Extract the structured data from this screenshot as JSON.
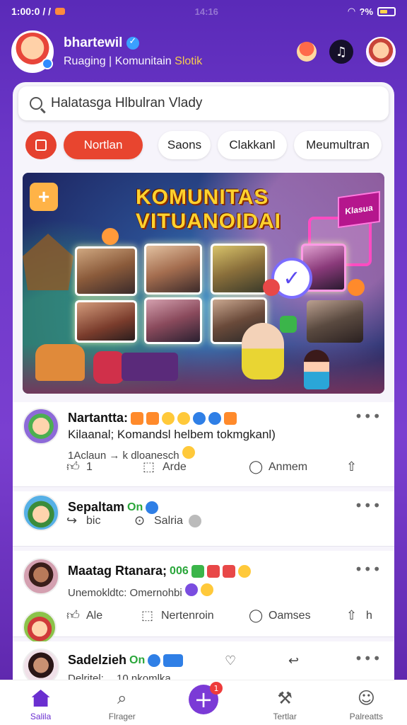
{
  "status_bar": {
    "time": "1:00:0 / /",
    "center": "14:16",
    "signal": "?%"
  },
  "header": {
    "title": "bhartewil",
    "subtitle": "Ruaging | Komunitain",
    "subtitle_highlight": "Slotik"
  },
  "search": {
    "placeholder": "Halatasga Hlbulran Vlady"
  },
  "chips": [
    {
      "label": "Nortlan",
      "active": true
    },
    {
      "label": "Saons",
      "active": false
    },
    {
      "label": "Clakkanl",
      "active": false
    },
    {
      "label": "Meumultran",
      "active": false
    }
  ],
  "banner": {
    "title_line1": "KOMUNITAS",
    "title_line2": "VITUANOIDAI",
    "sign_text": "Klasua"
  },
  "posts": [
    {
      "name": "Nartantta:",
      "text": "Kilaanal; Komandsl helbem tokmgkanl)",
      "sub": "1Aclaun → k dloanesch",
      "actions": [
        "1",
        "Arde",
        "Anmem",
        ""
      ]
    },
    {
      "name": "Sepaltam",
      "tag": "On",
      "actions": [
        "bic",
        "Salria"
      ]
    },
    {
      "name": "Maatag Rtanara;",
      "tag": "006",
      "text": "Unemokldtc: Omernohbi",
      "actions": [
        "Ale",
        "Nertenroin",
        "Oamses",
        "h"
      ]
    },
    {
      "name": "Sadelzieh",
      "tag": "On",
      "sub": "Delritel;",
      "sub2": "10 nkomlka"
    }
  ],
  "bottom_nav": [
    {
      "label": "Salila",
      "icon": "home-icon",
      "active": true
    },
    {
      "label": "Flrager",
      "icon": "search-icon",
      "active": false
    },
    {
      "label": "",
      "icon": "plus-icon",
      "active": false,
      "badge": "1"
    },
    {
      "label": "Tertlar",
      "icon": "trophy-icon",
      "active": false
    },
    {
      "label": "Palreatts",
      "icon": "profile-icon",
      "active": false
    }
  ],
  "colors": {
    "brand_purple": "#6a2fd0",
    "accent_red": "#e8452f",
    "header_bg": "#5a2ab8"
  }
}
